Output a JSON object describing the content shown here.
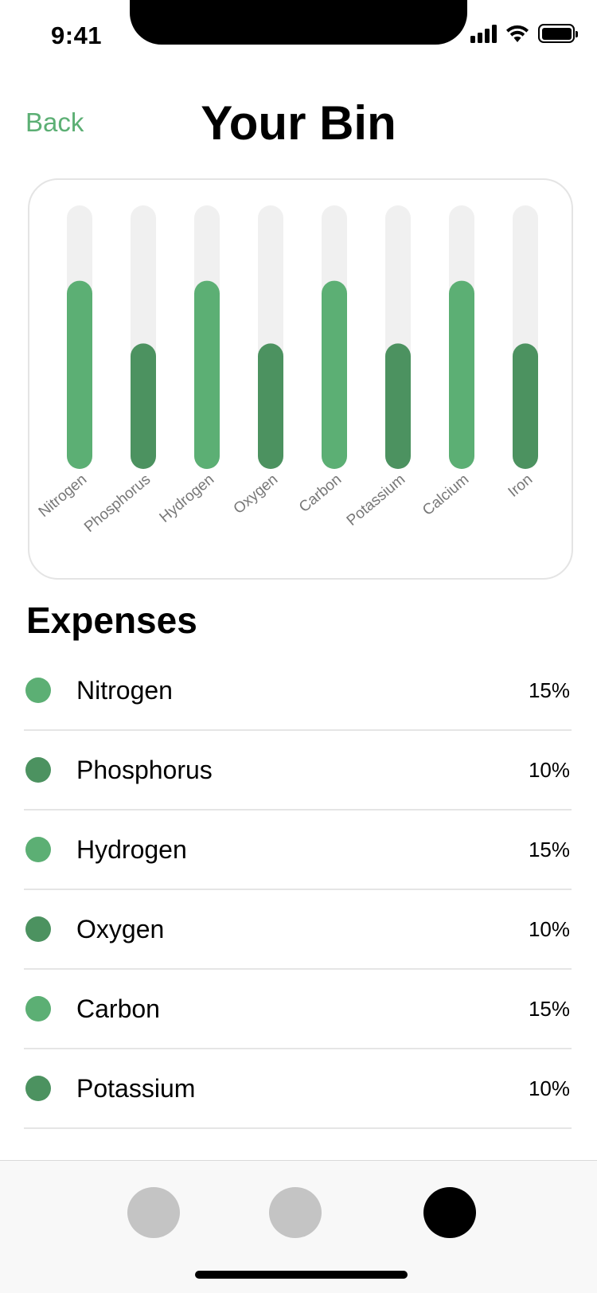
{
  "status_bar": {
    "time": "9:41",
    "icons": [
      "signal-icon",
      "wifi-icon",
      "battery-icon"
    ]
  },
  "header": {
    "back_label": "Back",
    "title": "Your Bin"
  },
  "colors": {
    "accent": "#5CAF74",
    "light_green": "#5CAF74",
    "dark_green": "#4C9260",
    "track": "#F0F0F0",
    "tab_inactive": "#C4C4C4",
    "tab_active": "#000000"
  },
  "chart_data": {
    "type": "bar",
    "categories": [
      "Nitrogen",
      "Phosphorus",
      "Hydrogen",
      "Oxygen",
      "Carbon",
      "Potassium",
      "Calcium",
      "Iron"
    ],
    "values": [
      15,
      10,
      15,
      10,
      15,
      10,
      15,
      10
    ],
    "ylim": [
      0,
      21
    ],
    "grid": false,
    "bar_colors": [
      "#5CAF74",
      "#4C9260",
      "#5CAF74",
      "#4C9260",
      "#5CAF74",
      "#4C9260",
      "#5CAF74",
      "#4C9260"
    ]
  },
  "expenses": {
    "title": "Expenses",
    "items": [
      {
        "name": "Nitrogen",
        "percent": "15%",
        "color": "#5CAF74"
      },
      {
        "name": "Phosphorus",
        "percent": "10%",
        "color": "#4C9260"
      },
      {
        "name": "Hydrogen",
        "percent": "15%",
        "color": "#5CAF74"
      },
      {
        "name": "Oxygen",
        "percent": "10%",
        "color": "#4C9260"
      },
      {
        "name": "Carbon",
        "percent": "15%",
        "color": "#5CAF74"
      },
      {
        "name": "Potassium",
        "percent": "10%",
        "color": "#4C9260"
      }
    ]
  },
  "tab_bar": {
    "tabs": [
      {
        "id": "tab-1",
        "active": false
      },
      {
        "id": "tab-2",
        "active": false
      },
      {
        "id": "tab-3",
        "active": true
      }
    ]
  }
}
